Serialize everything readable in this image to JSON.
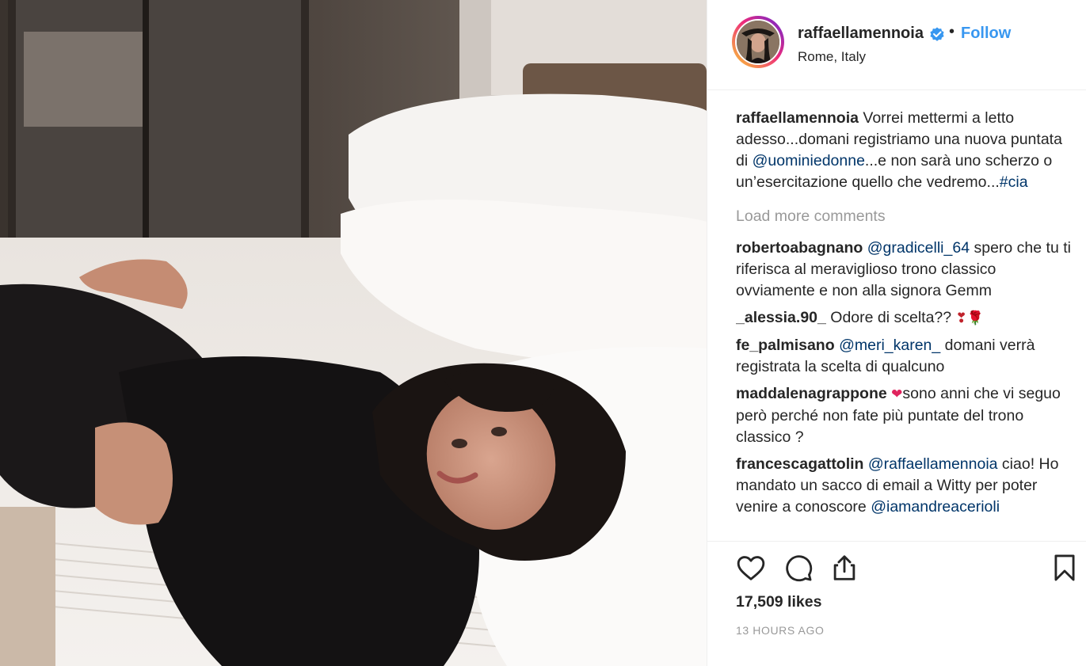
{
  "post": {
    "username": "raffaellamennoia",
    "follow_label": "Follow",
    "location": "Rome, Italy",
    "caption": {
      "username": "raffaellamennoia",
      "text_1": "Vorrei mettermi a letto adesso...domani registriamo una nuova puntata di ",
      "mention": "@uominiedonne",
      "text_2": "...e non sarà uno scherzo o un’esercitazione quello che vedremo...",
      "hashtag": "#cia"
    },
    "load_more": "Load more comments",
    "comments": [
      {
        "username": "robertoabagnano",
        "mention": "@gradicelli_64",
        "text": " spero che tu ti riferisca al meraviglioso trono classico ovviamente e non alla signora Gemm"
      },
      {
        "username": "_alessia.90_",
        "text": " Odore di scelta?? ",
        "emoji": "❣🌹"
      },
      {
        "username": "fe_palmisano",
        "mention": "@meri_karen_",
        "text": " domani verrà registrata la scelta di qualcuno"
      },
      {
        "username": "maddalenagrappone",
        "emoji": "❤",
        "text": "sono anni che vi seguo però perché non fate più puntate del trono classico ?"
      },
      {
        "username": "francescagattolin",
        "mention": "@raffaellamennoia",
        "text_1": " ciao! Ho mandato un sacco di email a Witty per poter venire a conoscore ",
        "mention_2": "@iamandreacerioli"
      }
    ],
    "likes": "17,509 likes",
    "timestamp": "13 HOURS AGO"
  },
  "icons": {
    "verified": "verified-badge-icon",
    "like": "heart-icon",
    "comment": "comment-bubble-icon",
    "share": "share-icon",
    "save": "bookmark-icon"
  },
  "colors": {
    "link": "#3897f0",
    "mention": "#003569",
    "muted": "#999999",
    "text": "#262626"
  }
}
